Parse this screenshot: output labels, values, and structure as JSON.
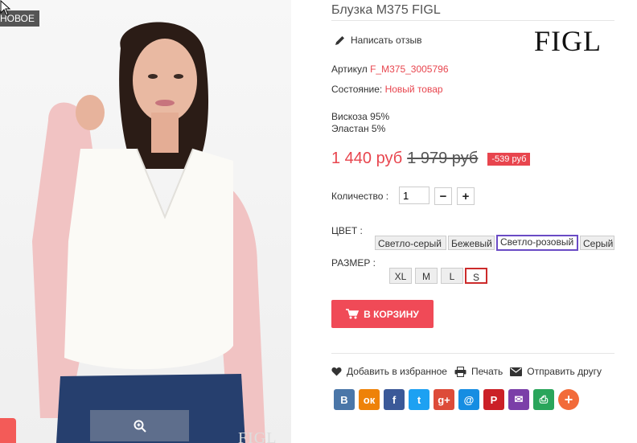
{
  "product": {
    "badge": "НОВОЕ",
    "title": "Блузка M375 FIGL",
    "review_link": "Написать отзыв",
    "brand": "FIGL",
    "image_watermark": "FIGL",
    "sku_label": "Артикул",
    "sku_value": "F_M375_3005796",
    "condition_label": "Состояние:",
    "condition_value": "Новый товар",
    "composition": [
      "Вискоза 95%",
      "Эластан 5%"
    ],
    "price": "1 440 руб",
    "old_price": "1 979 руб",
    "discount": "-539 руб"
  },
  "quantity": {
    "label": "Количество :",
    "value": "1",
    "minus": "−",
    "plus": "+"
  },
  "colors": {
    "label": "ЦВЕТ :",
    "options": [
      "Светло-серый",
      "Бежевый",
      "Светло-розовый",
      "Серый"
    ],
    "selected": "Светло-розовый"
  },
  "sizes": {
    "label": "РАЗМЕР :",
    "options": [
      "XL",
      "M",
      "L",
      "S"
    ],
    "selected": "S"
  },
  "cart_button": "В КОРЗИНУ",
  "actions": {
    "favorite": "Добавить в избранное",
    "print": "Печать",
    "send": "Отправить другу"
  },
  "social": [
    {
      "name": "vk",
      "glyph": "В",
      "color": "#4a76a8"
    },
    {
      "name": "odnoklassniki",
      "glyph": "ок",
      "color": "#ee8208"
    },
    {
      "name": "facebook",
      "glyph": "f",
      "color": "#3b5998"
    },
    {
      "name": "twitter",
      "glyph": "t",
      "color": "#1da1f2"
    },
    {
      "name": "google-plus",
      "glyph": "g+",
      "color": "#dd4b39"
    },
    {
      "name": "mail",
      "glyph": "@",
      "color": "#168de2"
    },
    {
      "name": "pinterest",
      "glyph": "P",
      "color": "#cb2027"
    },
    {
      "name": "email",
      "glyph": "✉",
      "color": "#7b3fa8"
    },
    {
      "name": "print",
      "glyph": "⎙",
      "color": "#2aa55b"
    },
    {
      "name": "more",
      "glyph": "+",
      "color": "#f26b3a"
    }
  ]
}
